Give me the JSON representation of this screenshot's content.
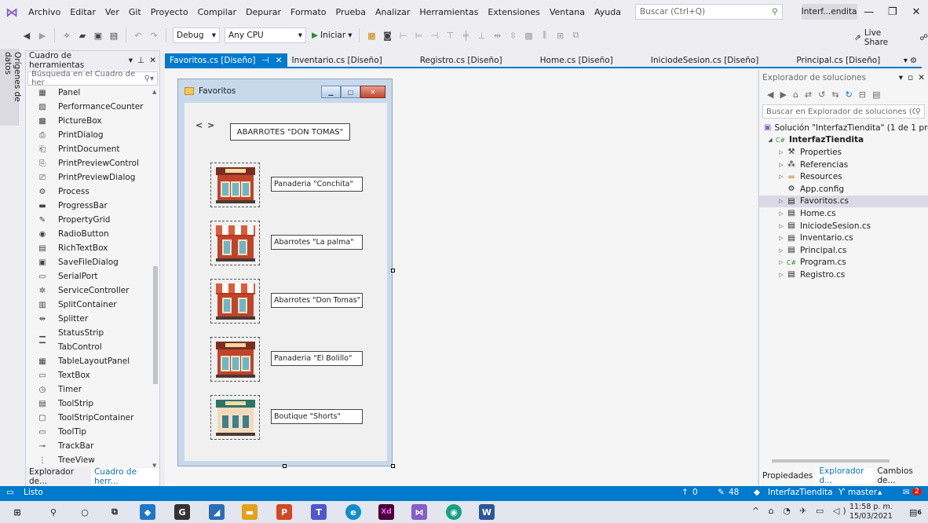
{
  "menu": {
    "items": [
      "Archivo",
      "Editar",
      "Ver",
      "Git",
      "Proyecto",
      "Compilar",
      "Depurar",
      "Formato",
      "Prueba",
      "Analizar",
      "Herramientas",
      "Extensiones",
      "Ventana",
      "Ayuda"
    ],
    "search_placeholder": "Buscar (Ctrl+Q)",
    "solution_title": "Interf...endita"
  },
  "toolbar": {
    "config": "Debug",
    "platform": "Any CPU",
    "start_label": "Iniciar",
    "live_share": "Live Share"
  },
  "side_tab": {
    "label": "Orígenes de datos"
  },
  "toolbox": {
    "title": "Cuadro de herramientas",
    "search_placeholder": "Búsqueda en el Cuadro de her",
    "items": [
      {
        "label": "Panel",
        "icon": "panel-icon"
      },
      {
        "label": "PerformanceCounter",
        "icon": "performance-counter-icon"
      },
      {
        "label": "PictureBox",
        "icon": "picture-box-icon"
      },
      {
        "label": "PrintDialog",
        "icon": "print-dialog-icon"
      },
      {
        "label": "PrintDocument",
        "icon": "print-document-icon"
      },
      {
        "label": "PrintPreviewControl",
        "icon": "print-preview-control-icon"
      },
      {
        "label": "PrintPreviewDialog",
        "icon": "print-preview-dialog-icon"
      },
      {
        "label": "Process",
        "icon": "process-icon"
      },
      {
        "label": "ProgressBar",
        "icon": "progress-bar-icon"
      },
      {
        "label": "PropertyGrid",
        "icon": "property-grid-icon"
      },
      {
        "label": "RadioButton",
        "icon": "radio-button-icon"
      },
      {
        "label": "RichTextBox",
        "icon": "rich-text-box-icon"
      },
      {
        "label": "SaveFileDialog",
        "icon": "save-file-dialog-icon"
      },
      {
        "label": "SerialPort",
        "icon": "serial-port-icon"
      },
      {
        "label": "ServiceController",
        "icon": "service-controller-icon"
      },
      {
        "label": "SplitContainer",
        "icon": "split-container-icon"
      },
      {
        "label": "Splitter",
        "icon": "splitter-icon"
      },
      {
        "label": "StatusStrip",
        "icon": "status-strip-icon"
      },
      {
        "label": "TabControl",
        "icon": "tab-control-icon"
      },
      {
        "label": "TableLayoutPanel",
        "icon": "table-layout-panel-icon"
      },
      {
        "label": "TextBox",
        "icon": "text-box-icon"
      },
      {
        "label": "Timer",
        "icon": "timer-icon"
      },
      {
        "label": "ToolStrip",
        "icon": "tool-strip-icon"
      },
      {
        "label": "ToolStripContainer",
        "icon": "tool-strip-container-icon"
      },
      {
        "label": "ToolTip",
        "icon": "tool-tip-icon"
      },
      {
        "label": "TrackBar",
        "icon": "track-bar-icon"
      },
      {
        "label": "TreeView",
        "icon": "tree-view-icon"
      }
    ],
    "bottom_tabs": [
      "Explorador de...",
      "Cuadro de herr..."
    ]
  },
  "doc_tabs": [
    {
      "label": "Favoritos.cs [Diseño]",
      "active": true
    },
    {
      "label": "Inventario.cs [Diseño]",
      "active": false
    },
    {
      "label": "Registro.cs [Diseño]",
      "active": false
    },
    {
      "label": "Home.cs [Diseño]",
      "active": false
    },
    {
      "label": "IniciodeSesion.cs [Diseño]",
      "active": false
    },
    {
      "label": "Principal.cs [Diseño]",
      "active": false
    }
  ],
  "form": {
    "title": "Favoritos",
    "nav": "< >",
    "header": "ABARROTES \"DON TOMAS\"",
    "stores": [
      {
        "label": "Panaderia \"Conchita\"",
        "style": "bakery"
      },
      {
        "label": "Abarrotes \"La palma\"",
        "style": "grocery"
      },
      {
        "label": "Abarrotes \"Don Tomas\"",
        "style": "grocery"
      },
      {
        "label": "Panaderia \"El Bolillo\"",
        "style": "bakery"
      },
      {
        "label": "Boutique \"Shorts\"",
        "style": "boutique"
      }
    ]
  },
  "solution_explorer": {
    "title": "Explorador de soluciones",
    "search_placeholder": "Buscar en Explorador de soluciones (Ctr",
    "solution": "Solución \"InterfazTiendita\" (1 de 1 proye",
    "project": "InterfazTiendita",
    "nodes": [
      {
        "label": "Properties",
        "icon": "wrench-icon",
        "expandable": true,
        "selected": false
      },
      {
        "label": "Referencias",
        "icon": "references-icon",
        "expandable": true,
        "selected": false
      },
      {
        "label": "Resources",
        "icon": "folder-icon",
        "expandable": true,
        "selected": false
      },
      {
        "label": "App.config",
        "icon": "config-file-icon",
        "expandable": false,
        "selected": false
      },
      {
        "label": "Favoritos.cs",
        "icon": "form-icon",
        "expandable": true,
        "selected": true
      },
      {
        "label": "Home.cs",
        "icon": "form-icon",
        "expandable": true,
        "selected": false
      },
      {
        "label": "IniciodeSesion.cs",
        "icon": "form-icon",
        "expandable": true,
        "selected": false
      },
      {
        "label": "Inventario.cs",
        "icon": "form-icon",
        "expandable": true,
        "selected": false
      },
      {
        "label": "Principal.cs",
        "icon": "form-icon",
        "expandable": true,
        "selected": false
      },
      {
        "label": "Program.cs",
        "icon": "csharp-file-icon",
        "expandable": true,
        "selected": false
      },
      {
        "label": "Registro.cs",
        "icon": "form-icon",
        "expandable": true,
        "selected": false
      }
    ],
    "bottom_tabs": [
      "Propiedades",
      "Explorador d...",
      "Cambios de..."
    ]
  },
  "status_bar": {
    "ready": "Listo",
    "up_count": "0",
    "edit_count": "48",
    "repo": "InterfazTiendita",
    "branch": "master",
    "notifications": "2"
  },
  "taskbar": {
    "time": "11:58 p. m.",
    "date": "15/03/2021",
    "notification_count": "6"
  },
  "colors": {
    "accent": "#007acc",
    "vs_purple": "#865fc5",
    "link": "#0e70c0"
  }
}
